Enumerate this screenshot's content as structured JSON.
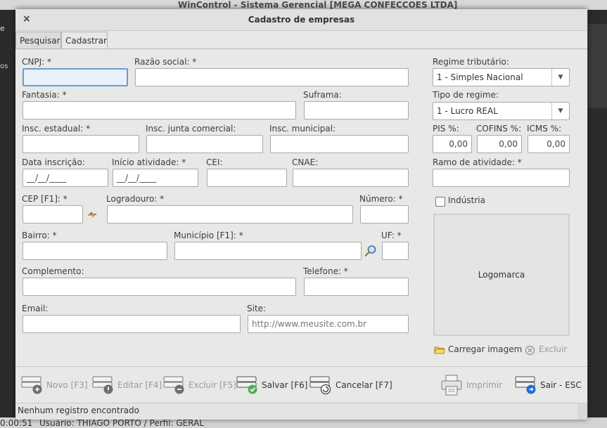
{
  "background": {
    "app_title": "WinControl - Sistema Gerencial [MEGA CONFECCOES LTDA]",
    "left_frag_1": "e",
    "left_frag_2": "os",
    "status_time": "0:00:51",
    "status_user": "Usuário: THIAGO PORTO / Perfil: GERAL"
  },
  "dialog": {
    "title": "Cadastro de empresas",
    "close_glyph": "×"
  },
  "tabs": [
    {
      "label": "Pesquisar",
      "active": false
    },
    {
      "label": "Cadastrar",
      "active": true
    }
  ],
  "form": {
    "cnpj": {
      "label": "CNPJ: *",
      "value": ""
    },
    "razao_social": {
      "label": "Razão social: *",
      "value": ""
    },
    "fantasia": {
      "label": "Fantasia: *",
      "value": ""
    },
    "suframa": {
      "label": "Suframa:",
      "value": ""
    },
    "insc_estadual": {
      "label": "Insc. estadual: *",
      "value": ""
    },
    "insc_junta": {
      "label": "Insc. junta comercial:",
      "value": ""
    },
    "insc_municipal": {
      "label": "Insc. municipal:",
      "value": ""
    },
    "data_inscricao": {
      "label": "Data inscrição:",
      "value": "__/__/____"
    },
    "inicio_atividade": {
      "label": "Início atividade: *",
      "value": "__/__/____"
    },
    "cei": {
      "label": "CEI:",
      "value": ""
    },
    "cnae": {
      "label": "CNAE:",
      "value": ""
    },
    "cep": {
      "label": "CEP [F1]: *",
      "value": ""
    },
    "logradouro": {
      "label": "Logradouro: *",
      "value": ""
    },
    "numero": {
      "label": "Número: *",
      "value": ""
    },
    "bairro": {
      "label": "Bairro: *",
      "value": ""
    },
    "municipio": {
      "label": "Município [F1]: *",
      "value": ""
    },
    "uf": {
      "label": "UF: *",
      "value": ""
    },
    "complemento": {
      "label": "Complemento:",
      "value": ""
    },
    "telefone": {
      "label": "Telefone: *",
      "value": ""
    },
    "email": {
      "label": "Email:",
      "value": ""
    },
    "site": {
      "label": "Site:",
      "value": "",
      "placeholder": "http://www.meusite.com.br"
    }
  },
  "side": {
    "regime_tributario": {
      "label": "Regime tributário:",
      "value": "1 - Simples Nacional"
    },
    "tipo_regime": {
      "label": "Tipo de regime:",
      "value": "1 - Lucro REAL"
    },
    "pis": {
      "label": "PIS %:",
      "value": "0,00"
    },
    "cofins": {
      "label": "COFINS %:",
      "value": "0,00"
    },
    "icms": {
      "label": "ICMS %:",
      "value": "0,00"
    },
    "ramo": {
      "label": "Ramo de atividade: *",
      "value": ""
    },
    "industria": {
      "label": "Indústria",
      "checked": false
    },
    "logomarca": "Logomarca",
    "carregar": "Carregar imagem",
    "excluir": "Excluir"
  },
  "toolbar": {
    "novo": "Novo [F3]",
    "editar": "Editar [F4]",
    "excluir": "Excluir [F5]",
    "salvar": "Salvar [F6]",
    "cancelar": "Cancelar [F7]",
    "imprimir": "Imprimir",
    "sair": "Sair - ESC"
  },
  "status": "Nenhum registro encontrado",
  "colors": {
    "focus_border": "#6b9bd1",
    "focus_bg": "#e9f0fa",
    "disabled_text": "#9a9a9a"
  }
}
